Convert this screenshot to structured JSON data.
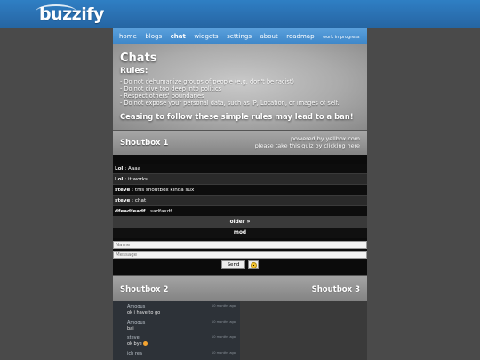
{
  "site": {
    "logo": "buzzify"
  },
  "nav": [
    {
      "label": "home"
    },
    {
      "label": "blogs"
    },
    {
      "label": "chat",
      "active": true
    },
    {
      "label": "widgets"
    },
    {
      "label": "settings"
    },
    {
      "label": "about"
    },
    {
      "label": "roadmap"
    },
    {
      "label": "work in progress"
    }
  ],
  "rules": {
    "title": "Chats",
    "heading": "Rules:",
    "items": [
      "- Do not dehumanize groups of people (e.g. don't be racist)",
      "- Do not dive too deep into politics",
      "- Respect others' boundaries",
      "- Do not expose your personal data, such as IP, Location, or images of self."
    ],
    "warning": "Ceasing to follow these simple rules may lead to a ban!"
  },
  "shoutbox1": {
    "title": "Shoutbox 1",
    "credit_line1": "powered by yellbox.com",
    "credit_line2": "please take this quiz by clicking here",
    "messages": [
      {
        "user": "Lol",
        "text": "Aaaa"
      },
      {
        "user": "Lol",
        "text": "it works"
      },
      {
        "user": "steve",
        "text": "this shoutbox kinda sux"
      },
      {
        "user": "steve",
        "text": "chat"
      },
      {
        "user": "dfeadfeadf",
        "text": "sadfaxdf"
      }
    ],
    "older_label": "older »",
    "mod_label": "mod",
    "name_placeholder": "Name",
    "message_placeholder": "Message",
    "send_label": "Send"
  },
  "shoutbox2": {
    "title": "Shoutbox 2"
  },
  "shoutbox3": {
    "title": "Shoutbox 3"
  },
  "feed": [
    {
      "user": "Amogus",
      "time": "10 months ago",
      "text": "ok i have to go"
    },
    {
      "user": "Amogus",
      "time": "10 months ago",
      "text": "bai"
    },
    {
      "user": "steve",
      "time": "10 months ago",
      "text": "ok bye"
    },
    {
      "user": "ich rea",
      "time": "10 months ago",
      "text": ""
    }
  ]
}
